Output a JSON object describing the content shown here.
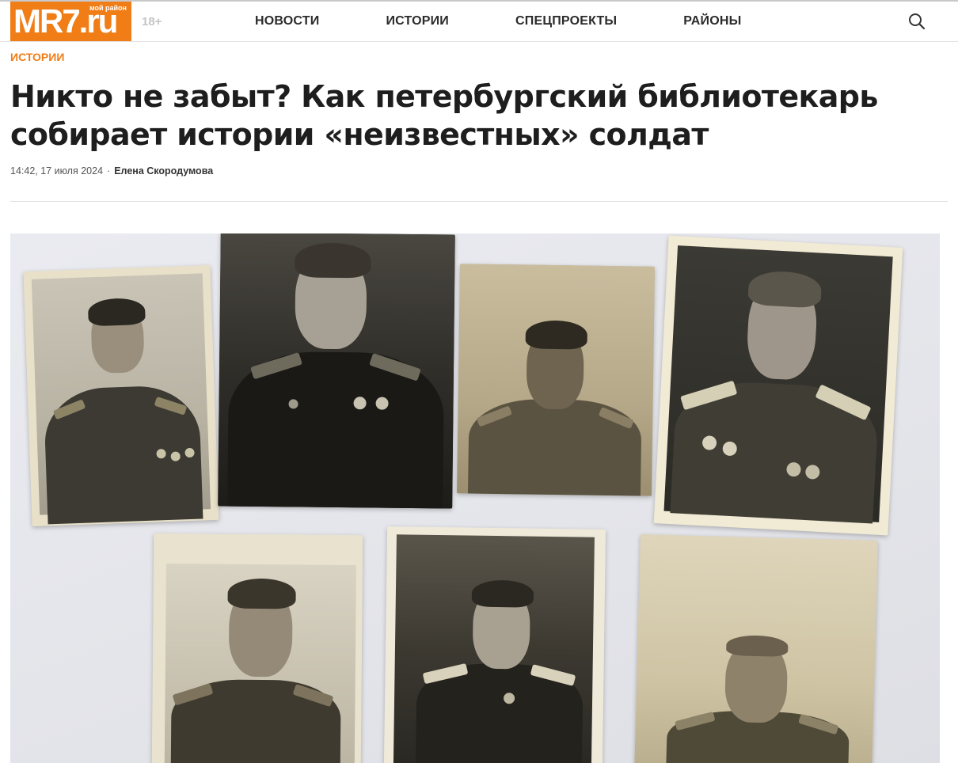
{
  "header": {
    "logo_main": "MR7.ru",
    "logo_small": "мой район",
    "age_rating": "18+",
    "nav": [
      {
        "label": "НОВОСТИ"
      },
      {
        "label": "ИСТОРИИ"
      },
      {
        "label": "СПЕЦПРОЕКТЫ"
      },
      {
        "label": "РАЙОНЫ"
      }
    ],
    "search_icon": "search-icon"
  },
  "article": {
    "rubric": "ИСТОРИИ",
    "title": "Никто не забыт? Как петербургский библиотекарь собирает истории «неизвестных» солдат",
    "datetime": "14:42, 17 июля 2024",
    "separator": "·",
    "author": "Елена Скородумова"
  },
  "colors": {
    "brand": "#f07d16",
    "text": "#1e1e1e"
  }
}
